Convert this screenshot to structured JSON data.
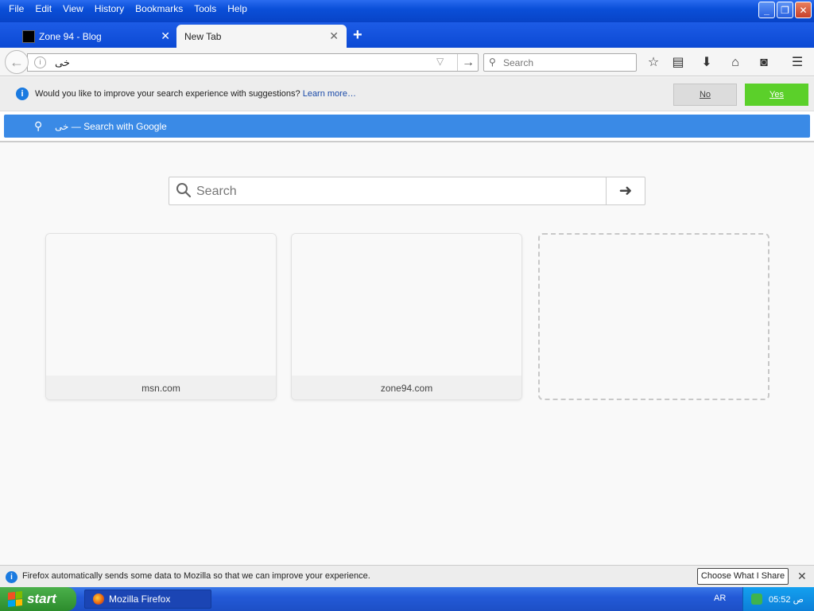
{
  "menu": [
    "File",
    "Edit",
    "View",
    "History",
    "Bookmarks",
    "Tools",
    "Help"
  ],
  "tabs": [
    {
      "title": "Zone 94 - Blog",
      "close": "✕"
    },
    {
      "title": "New Tab",
      "close": "✕"
    }
  ],
  "new_tab_symbol": "+",
  "urlbar": {
    "value": "خى"
  },
  "searchbar": {
    "placeholder": "Search"
  },
  "popup": {
    "optin_text": "Would you like to improve your search experience with suggestions? ",
    "learn_more": "Learn more…",
    "no_label": "No",
    "yes_label": "Yes",
    "suggestion": "خى — Search with Google"
  },
  "newtab": {
    "search_placeholder": "Search",
    "tiles": [
      {
        "label": "msn.com"
      },
      {
        "label": "zone94.com"
      }
    ]
  },
  "notification": {
    "text": "Firefox automatically sends some data to Mozilla so that we can improve your experience.",
    "button": "Choose What I Share"
  },
  "taskbar": {
    "start": "start",
    "window": "Mozilla Firefox",
    "language": "AR",
    "clock": "05:52 ص"
  },
  "colors": {
    "accent": "#3a8ae6",
    "yes_button": "#5bd02a",
    "taskbar": "#235ad8"
  }
}
